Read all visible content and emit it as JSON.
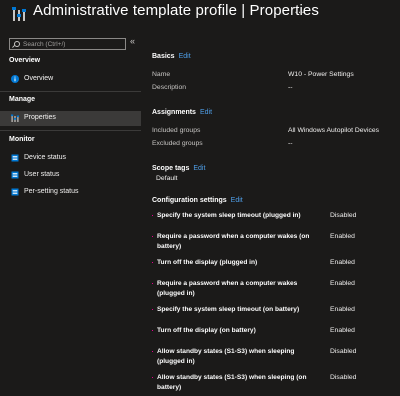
{
  "header": {
    "title": "Administrative template profile | Properties",
    "more": "…"
  },
  "sidebar": {
    "search_placeholder": "Search (Ctrl+/)",
    "collapse": "«",
    "sections": [
      "Overview",
      "Manage",
      "Monitor"
    ],
    "items": {
      "overview": "Overview",
      "properties": "Properties",
      "device_status": "Device status",
      "user_status": "User status",
      "per_setting_status": "Per-setting status"
    }
  },
  "edit_label": "Edit",
  "basics": {
    "title": "Basics",
    "name_label": "Name",
    "name_value": "W10 - Power Settings",
    "description_label": "Description",
    "description_value": "--"
  },
  "assignments": {
    "title": "Assignments",
    "included_label": "Included groups",
    "included_value": "All Windows Autopilot Devices",
    "excluded_label": "Excluded groups",
    "excluded_value": "--"
  },
  "scope_tags": {
    "title": "Scope tags",
    "value": "Default"
  },
  "configuration": {
    "title": "Configuration settings",
    "settings": [
      {
        "name": "Specify the system sleep timeout (plugged in)",
        "value": "Disabled"
      },
      {
        "name": "Require a password when a computer wakes (on battery)",
        "value": "Enabled"
      },
      {
        "name": "Turn off the display (plugged in)",
        "value": "Enabled"
      },
      {
        "name": "Require a password when a computer wakes (plugged in)",
        "value": "Enabled"
      },
      {
        "name": "Specify the system sleep timeout (on battery)",
        "value": "Enabled"
      },
      {
        "name": "Turn off the display (on battery)",
        "value": "Enabled"
      },
      {
        "name": "Allow standby states (S1-S3) when sleeping (plugged in)",
        "value": "Disabled"
      },
      {
        "name": "Allow standby states (S1-S3) when sleeping (on battery)",
        "value": "Disabled"
      }
    ]
  }
}
